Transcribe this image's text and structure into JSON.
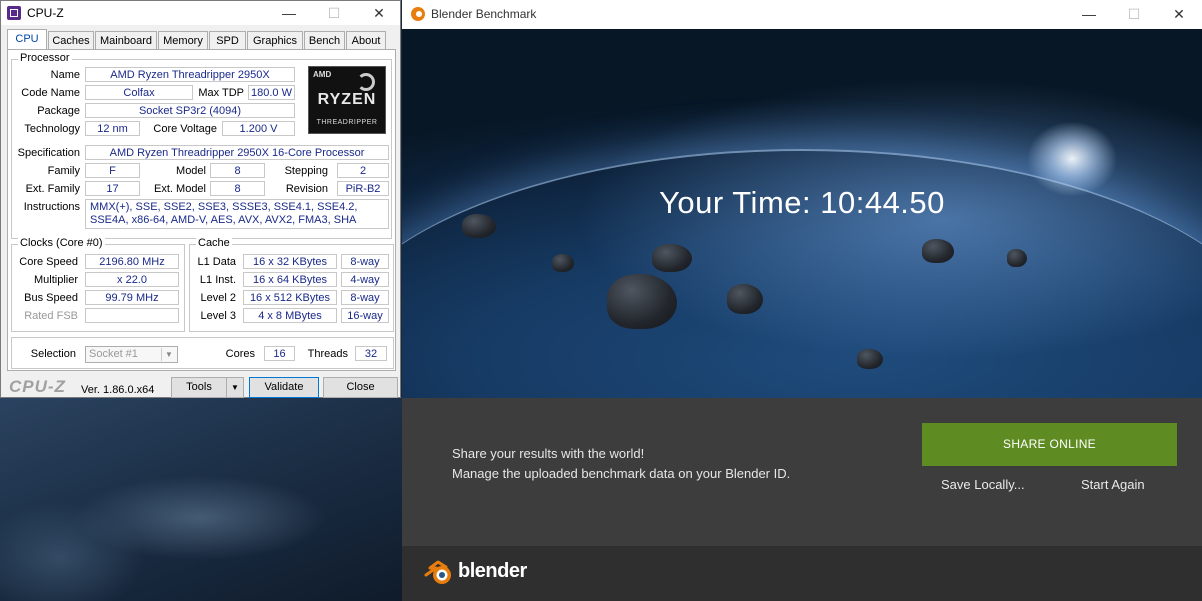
{
  "cpuz": {
    "title": "CPU-Z",
    "tabs": [
      "CPU",
      "Caches",
      "Mainboard",
      "Memory",
      "SPD",
      "Graphics",
      "Bench",
      "About"
    ],
    "processor": {
      "group_title": "Processor",
      "name_label": "Name",
      "name": "AMD Ryzen Threadripper 2950X",
      "codename_label": "Code Name",
      "codename": "Colfax",
      "maxtdp_label": "Max TDP",
      "maxtdp": "180.0 W",
      "package_label": "Package",
      "package": "Socket SP3r2 (4094)",
      "technology_label": "Technology",
      "technology": "12 nm",
      "corevoltage_label": "Core Voltage",
      "corevoltage": "1.200 V",
      "specification_label": "Specification",
      "specification": "AMD Ryzen Threadripper 2950X 16-Core Processor",
      "family_label": "Family",
      "family": "F",
      "model_label": "Model",
      "model": "8",
      "stepping_label": "Stepping",
      "stepping": "2",
      "extfamily_label": "Ext. Family",
      "extfamily": "17",
      "extmodel_label": "Ext. Model",
      "extmodel": "8",
      "revision_label": "Revision",
      "revision": "PiR-B2",
      "instructions_label": "Instructions",
      "instructions": "MMX(+), SSE, SSE2, SSE3, SSSE3, SSE4.1, SSE4.2, SSE4A, x86-64, AMD-V, AES, AVX, AVX2, FMA3, SHA",
      "logo": {
        "brand": "AMD",
        "line": "RYZEN",
        "sub": "THREADRIPPER"
      }
    },
    "clocks": {
      "group_title": "Clocks (Core #0)",
      "corespeed_label": "Core Speed",
      "corespeed": "2196.80 MHz",
      "multiplier_label": "Multiplier",
      "multiplier": "x 22.0",
      "busspeed_label": "Bus Speed",
      "busspeed": "99.79 MHz",
      "ratedfsb_label": "Rated FSB",
      "ratedfsb": ""
    },
    "cache": {
      "group_title": "Cache",
      "rows": [
        {
          "label": "L1 Data",
          "size": "16 x 32 KBytes",
          "way": "8-way"
        },
        {
          "label": "L1 Inst.",
          "size": "16 x 64 KBytes",
          "way": "4-way"
        },
        {
          "label": "Level 2",
          "size": "16 x 512 KBytes",
          "way": "8-way"
        },
        {
          "label": "Level 3",
          "size": "4 x 8 MBytes",
          "way": "16-way"
        }
      ]
    },
    "selection": {
      "label": "Selection",
      "value": "Socket #1",
      "cores_label": "Cores",
      "cores": "16",
      "threads_label": "Threads",
      "threads": "32"
    },
    "footer": {
      "brand": "CPU-Z",
      "version": "Ver. 1.86.0.x64",
      "tools": "Tools",
      "validate": "Validate",
      "close": "Close"
    }
  },
  "blender": {
    "title": "Blender Benchmark",
    "result": "Your Time: 10:44.50",
    "share_line1": "Share your results with the world!",
    "share_line2": "Manage the uploaded benchmark data on your Blender ID.",
    "share_button": "SHARE ONLINE",
    "save_locally": "Save Locally...",
    "start_again": "Start Again",
    "logo_text": "blender",
    "accent": "#5e8c23"
  },
  "window_controls": {
    "minimize": "—",
    "maximize": "☐",
    "close": "✕"
  }
}
